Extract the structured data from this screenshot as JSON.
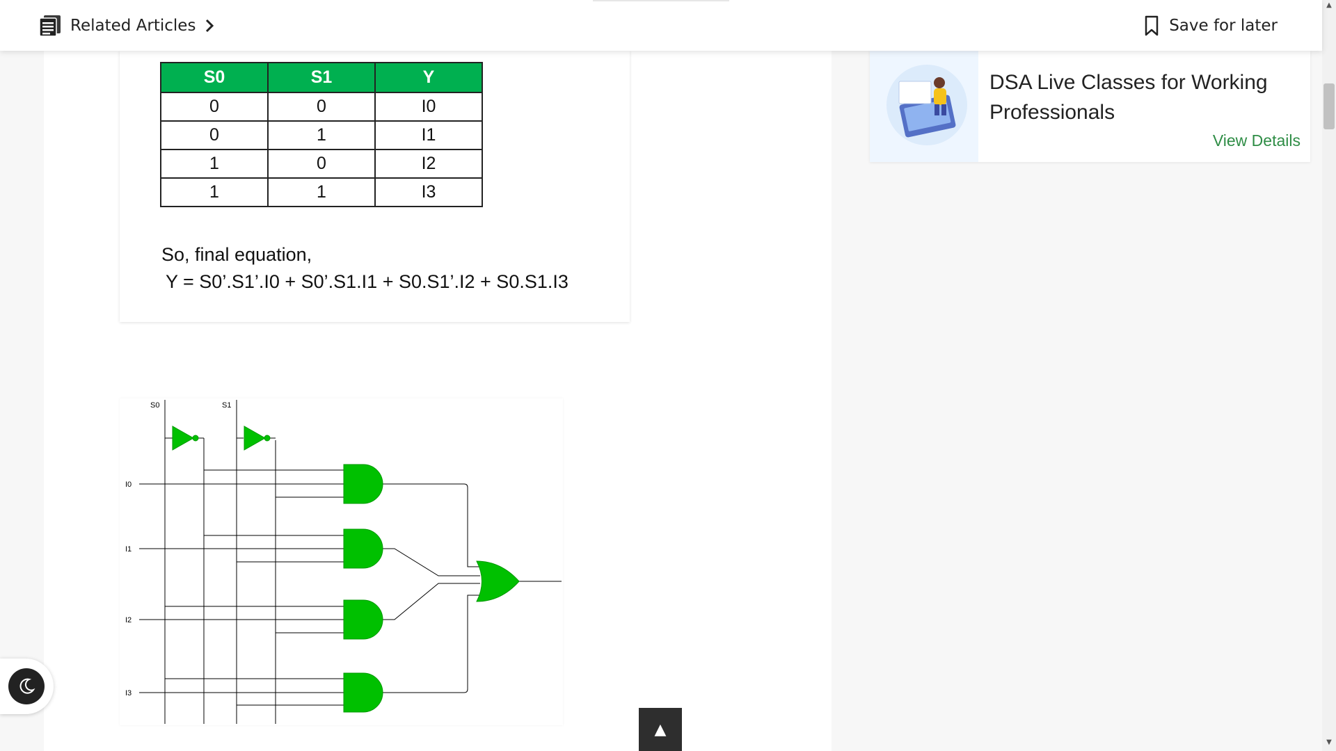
{
  "header": {
    "related_label": "Related Articles",
    "save_label": "Save for later"
  },
  "truth_table": {
    "headers": [
      "S0",
      "S1",
      "Y"
    ],
    "rows": [
      [
        "0",
        "0",
        "I0"
      ],
      [
        "0",
        "1",
        "I1"
      ],
      [
        "1",
        "0",
        "I2"
      ],
      [
        "1",
        "1",
        "I3"
      ]
    ]
  },
  "equation": {
    "line1": "So, final equation,",
    "line2": "Y = S0’.S1’.I0 + S0’.S1.I1 + S0.S1’.I2 + S0.S1.I3"
  },
  "circuit": {
    "select_labels": [
      "S0",
      "S1"
    ],
    "input_labels": [
      "I0",
      "I1",
      "I2",
      "I3"
    ],
    "gate_color": "#00c000"
  },
  "promo": {
    "title": "DSA Live Classes for Working Professionals",
    "link": "View Details"
  },
  "back_to_top": "▲",
  "colors": {
    "accent_green": "#2f8d46",
    "table_header": "#00b050"
  }
}
